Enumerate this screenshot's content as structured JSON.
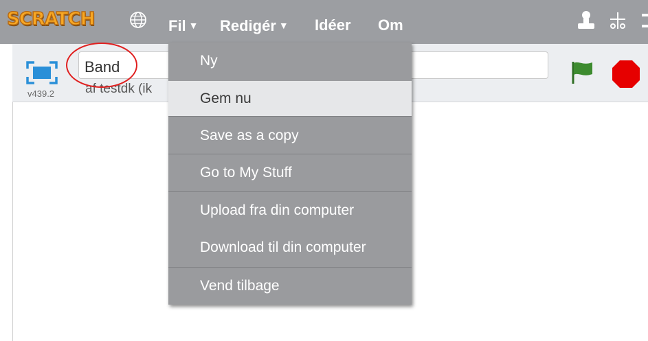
{
  "topbar": {
    "logo": "SCRATCH",
    "globe_icon": "globe-icon",
    "menus": [
      {
        "label": "Fil",
        "has_caret": true
      },
      {
        "label": "Redigér",
        "has_caret": true
      },
      {
        "label": "Idéer",
        "has_caret": false
      },
      {
        "label": "Om",
        "has_caret": false
      }
    ],
    "caret": "▼",
    "right_icons": [
      "duplicate-icon",
      "cut-icon"
    ]
  },
  "project": {
    "title": "Band",
    "author": "af testdk (ik",
    "version": "v439.2"
  },
  "file_menu": {
    "items": [
      {
        "label": "Ny"
      },
      {
        "label": "Gem nu",
        "selected": true
      },
      {
        "label": "Save as a copy"
      },
      {
        "label": "Go to My Stuff"
      },
      {
        "label": "Upload fra din computer"
      },
      {
        "label": "Download til din computer"
      },
      {
        "label": "Vend tilbage"
      }
    ]
  },
  "colors": {
    "topbar": "#9c9ea2",
    "menu_bg": "#9a9b9e",
    "menu_selected": "#e6e7e9",
    "highlight": "#e02020",
    "flag": "#3d8b2f",
    "stop": "#e60000"
  }
}
